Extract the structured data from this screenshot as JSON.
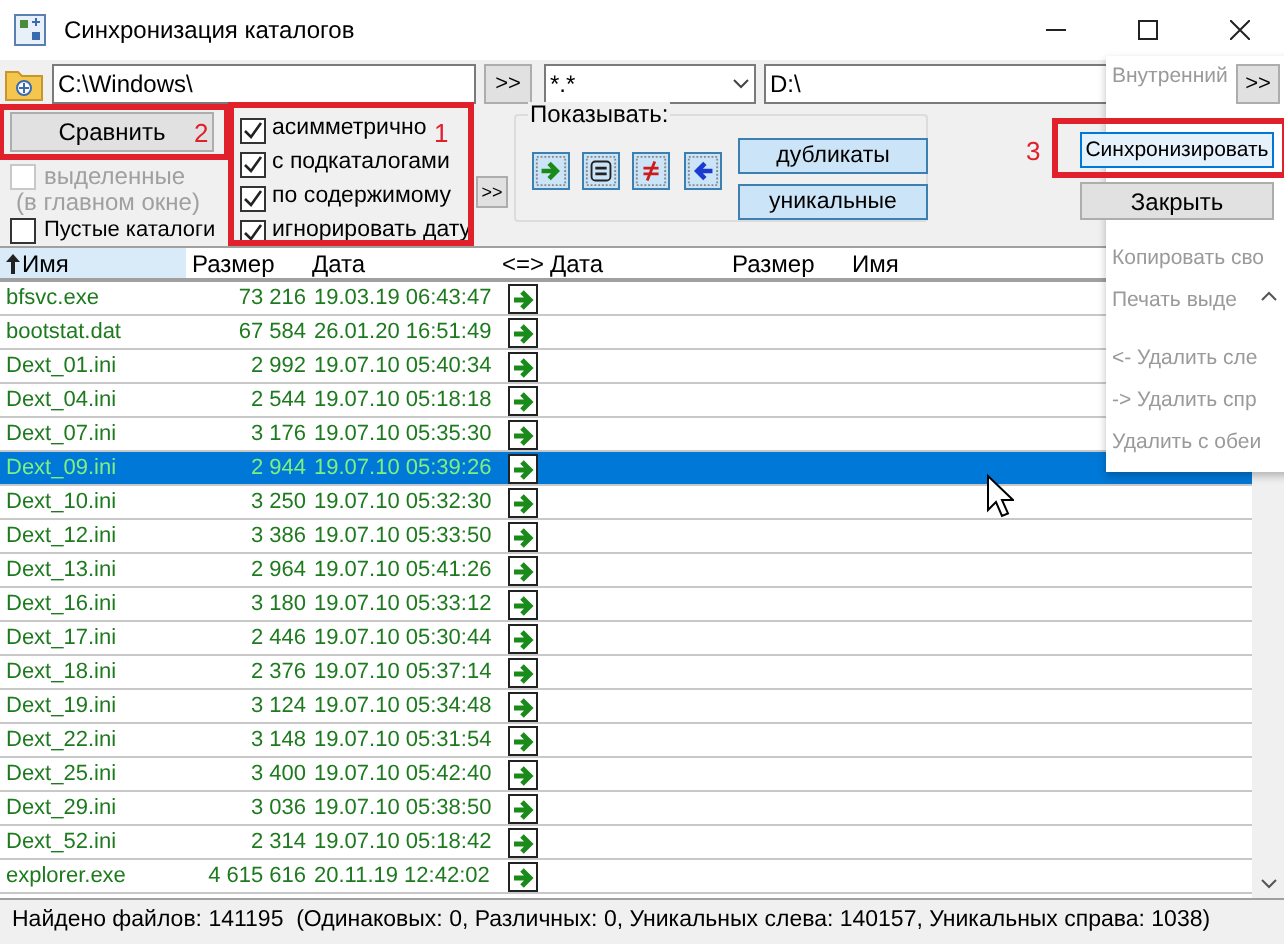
{
  "window": {
    "title": "Синхронизация каталогов"
  },
  "left_path": {
    "value": "C:\\Windows\\"
  },
  "left_go": {
    "label": ">>"
  },
  "mask": {
    "value": "*.*"
  },
  "right_path": {
    "value": "D:\\"
  },
  "right_go": {
    "label": ">>"
  },
  "compare_button": {
    "label": "Сравнить",
    "annotation": "2"
  },
  "selected_only": {
    "label": "выделенные",
    "note": "(в главном окне)",
    "checked": false,
    "disabled": true
  },
  "empty_dirs": {
    "label": "Пустые каталоги",
    "checked": false
  },
  "options": {
    "annotation": "1",
    "items": [
      {
        "label": "асимметрично",
        "checked": true
      },
      {
        "label": "с подкаталогами",
        "checked": true
      },
      {
        "label": "по содержимому",
        "checked": true
      },
      {
        "label": "игнорировать дату",
        "checked": true
      }
    ]
  },
  "options_go": {
    "label": ">>"
  },
  "show": {
    "label": "Показывать:",
    "filters": [
      {
        "kind": "right"
      },
      {
        "kind": "equal"
      },
      {
        "kind": "different"
      },
      {
        "kind": "left"
      }
    ],
    "buttons": [
      "дубликаты",
      "уникальные"
    ]
  },
  "sync_button": {
    "label": "Синхронизировать",
    "annotation": "3"
  },
  "close_button": {
    "label": "Закрыть"
  },
  "columns": [
    {
      "label": "Имя",
      "sorted": true
    },
    {
      "label": "Размер",
      "sorted": false
    },
    {
      "label": "Дата",
      "sorted": false
    },
    {
      "label": "<=>",
      "sorted": false
    },
    {
      "label": "Дата",
      "sorted": false
    },
    {
      "label": "Размер",
      "sorted": false
    },
    {
      "label": "Имя",
      "sorted": false
    }
  ],
  "rows": [
    {
      "name": "bfsvc.exe",
      "size": "73 216",
      "date": "19.03.19 06:43:47",
      "kind": "right",
      "selected": false
    },
    {
      "name": "bootstat.dat",
      "size": "67 584",
      "date": "26.01.20 16:51:49",
      "kind": "right",
      "selected": false
    },
    {
      "name": "Dext_01.ini",
      "size": "2 992",
      "date": "19.07.10 05:40:34",
      "kind": "right",
      "selected": false
    },
    {
      "name": "Dext_04.ini",
      "size": "2 544",
      "date": "19.07.10 05:18:18",
      "kind": "right",
      "selected": false
    },
    {
      "name": "Dext_07.ini",
      "size": "3 176",
      "date": "19.07.10 05:35:30",
      "kind": "right",
      "selected": false
    },
    {
      "name": "Dext_09.ini",
      "size": "2 944",
      "date": "19.07.10 05:39:26",
      "kind": "right",
      "selected": true
    },
    {
      "name": "Dext_10.ini",
      "size": "3 250",
      "date": "19.07.10 05:32:30",
      "kind": "right",
      "selected": false
    },
    {
      "name": "Dext_12.ini",
      "size": "3 386",
      "date": "19.07.10 05:33:50",
      "kind": "right",
      "selected": false
    },
    {
      "name": "Dext_13.ini",
      "size": "2 964",
      "date": "19.07.10 05:41:26",
      "kind": "right",
      "selected": false
    },
    {
      "name": "Dext_16.ini",
      "size": "3 180",
      "date": "19.07.10 05:33:12",
      "kind": "right",
      "selected": false
    },
    {
      "name": "Dext_17.ini",
      "size": "2 446",
      "date": "19.07.10 05:30:44",
      "kind": "right",
      "selected": false
    },
    {
      "name": "Dext_18.ini",
      "size": "2 376",
      "date": "19.07.10 05:37:14",
      "kind": "right",
      "selected": false
    },
    {
      "name": "Dext_19.ini",
      "size": "3 124",
      "date": "19.07.10 05:34:48",
      "kind": "right",
      "selected": false
    },
    {
      "name": "Dext_22.ini",
      "size": "3 148",
      "date": "19.07.10 05:31:54",
      "kind": "right",
      "selected": false
    },
    {
      "name": "Dext_25.ini",
      "size": "3 400",
      "date": "19.07.10 05:42:40",
      "kind": "right",
      "selected": false
    },
    {
      "name": "Dext_29.ini",
      "size": "3 036",
      "date": "19.07.10 05:38:50",
      "kind": "right",
      "selected": false
    },
    {
      "name": "Dext_52.ini",
      "size": "2 314",
      "date": "19.07.10 05:18:42",
      "kind": "right",
      "selected": false
    },
    {
      "name": "explorer.exe",
      "size": "4 615 616",
      "date": "20.11.19 12:42:02",
      "kind": "right",
      "selected": false
    }
  ],
  "context_menu": [
    {
      "kind": "item",
      "label": "Внутренний"
    },
    {
      "kind": "gap"
    },
    {
      "kind": "item",
      "label": "Копировать сво"
    },
    {
      "kind": "item",
      "label": "Печать выде"
    },
    {
      "kind": "separator"
    },
    {
      "kind": "item",
      "label": "<- Удалить сле"
    },
    {
      "kind": "item",
      "label": "-> Удалить спр"
    },
    {
      "kind": "item",
      "label": "Удалить с обеи"
    }
  ],
  "status_bar": "Найдено файлов: 141195  (Одинаковых: 0, Различных: 0, Уникальных слева: 140157, Уникальных справа: 1038)"
}
